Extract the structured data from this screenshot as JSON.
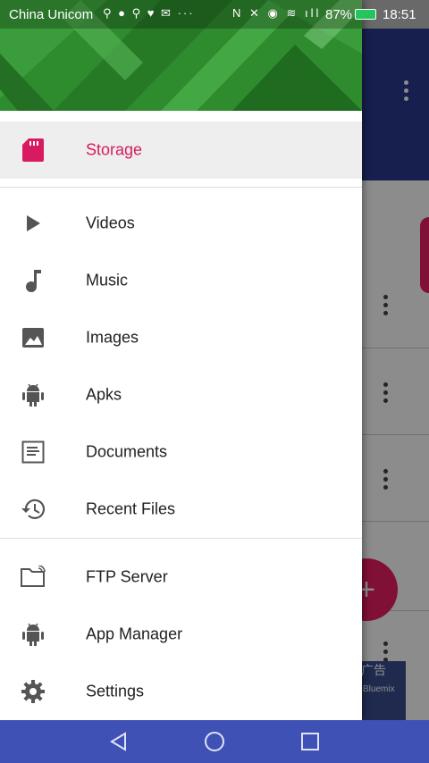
{
  "status_bar": {
    "carrier": "China Unicom",
    "icons_left": "⚲ ● ⚲ ♥ ✉ ···",
    "battery_percent": "87%",
    "time": "18:51"
  },
  "drawer": {
    "active_item": {
      "label": "Storage",
      "icon": "sd-card-icon",
      "color": "#d81b60"
    },
    "section1": [
      {
        "label": "Videos",
        "icon": "play-icon"
      },
      {
        "label": "Music",
        "icon": "music-note-icon"
      },
      {
        "label": "Images",
        "icon": "image-icon"
      },
      {
        "label": "Apks",
        "icon": "android-icon"
      },
      {
        "label": "Documents",
        "icon": "document-icon"
      },
      {
        "label": "Recent Files",
        "icon": "history-icon"
      }
    ],
    "section2": [
      {
        "label": "FTP Server",
        "icon": "ftp-folder-icon"
      },
      {
        "label": "App Manager",
        "icon": "android-icon"
      },
      {
        "label": "Settings",
        "icon": "gear-icon"
      }
    ]
  },
  "background": {
    "fab_symbol": "+",
    "ad_label": "广告",
    "ad_text": "Bluemix"
  },
  "colors": {
    "primary": "#3f51b5",
    "accent": "#e91e63",
    "header_green": "#2e8b2e"
  }
}
